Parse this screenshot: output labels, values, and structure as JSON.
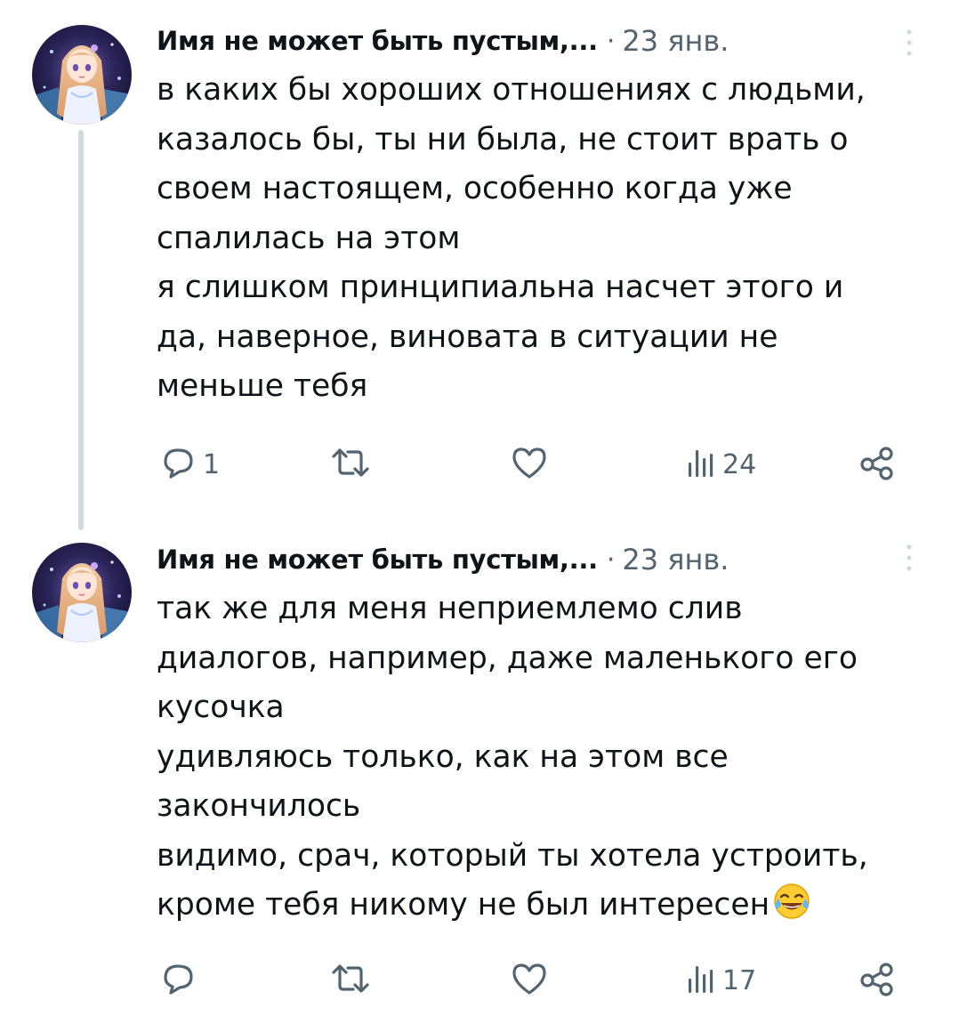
{
  "tweets": [
    {
      "author": "Имя не может быть пустым,...",
      "separator": "·",
      "date": "23 янв.",
      "lines": [
        "в каких бы хороших отношениях с людьми,",
        "казалось бы, ты ни была, не стоит врать о",
        "своем настоящем, особенно когда уже",
        "спалилась на этом",
        "я слишком принципиальна насчет этого и",
        "да, наверное, виновата в ситуации не",
        "меньше тебя"
      ],
      "reply_count": "1",
      "retweet_count": "",
      "like_count": "",
      "view_count": "24"
    },
    {
      "author": "Имя не может быть пустым,...",
      "separator": "·",
      "date": "23 янв.",
      "lines": [
        "так же для меня неприемлемо слив",
        "диалогов, например, даже маленького его",
        "кусочка",
        "удивляюсь только, как на этом все",
        "закончилось",
        "видимо, срач, который ты хотела устроить,",
        "кроме тебя никому не был интересен"
      ],
      "emoji": "face-with-tears-of-joy",
      "reply_count": "",
      "retweet_count": "",
      "like_count": "",
      "view_count": "17"
    }
  ],
  "icons": {
    "reply": "reply-icon",
    "retweet": "retweet-icon",
    "like": "heart-icon",
    "views": "views-icon",
    "share": "share-icon",
    "more": "more-icon"
  },
  "colors": {
    "text": "#0f1419",
    "secondary": "#536471",
    "thread_line": "#cfd9de"
  }
}
